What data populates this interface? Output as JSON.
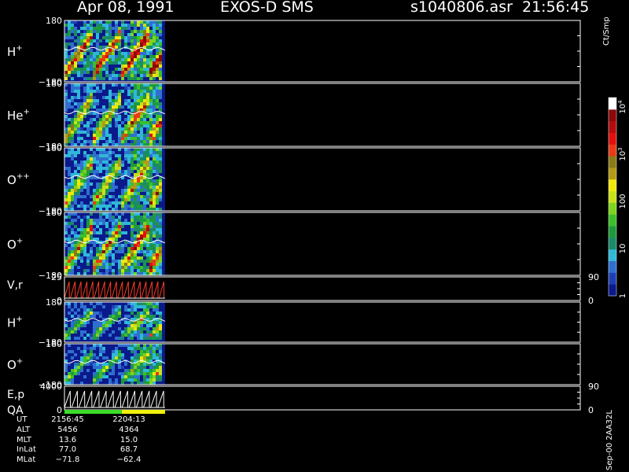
{
  "header": {
    "date": "Apr 08, 1991",
    "instrument": "EXOS-D SMS",
    "file_time": "s1040806.asr  21:56:45"
  },
  "colors": {
    "background": "#000000",
    "axes": "#ffffff",
    "colorscale": [
      "#0a1a8a",
      "#1e3fb4",
      "#2f6fd0",
      "#2fb8d8",
      "#1a8a6a",
      "#1e9a3c",
      "#3cbf2a",
      "#7ed41e",
      "#c8e01a",
      "#f0e80c",
      "#b49a14",
      "#8a7a18",
      "#e83a14",
      "#e0100c",
      "#b40c0c",
      "#8a0808",
      "#ffffff"
    ]
  },
  "colorbar": {
    "title": "Ct/Smp",
    "ticks": [
      {
        "value": 1,
        "label": "1"
      },
      {
        "value": 10,
        "label": "10"
      },
      {
        "value": 100,
        "label": "100"
      },
      {
        "value": 1000,
        "label": "10",
        "sup": "3"
      },
      {
        "value": 10000,
        "label": "10",
        "sup": "4"
      }
    ]
  },
  "chart_data": [
    {
      "type": "heatmap",
      "panel": "pitch-angle H+",
      "species": "H",
      "charge": "+",
      "y_range": [
        -180,
        180
      ],
      "y_tick_labels": [
        "180",
        "−180"
      ],
      "data_fraction": 0.195,
      "peak_level": 0.9,
      "noise_level": 0.35
    },
    {
      "type": "heatmap",
      "panel": "pitch-angle He+",
      "species": "He",
      "charge": "+",
      "y_range": [
        -180,
        180
      ],
      "y_tick_labels": [
        "180",
        "−180"
      ],
      "data_fraction": 0.195,
      "peak_level": 0.7,
      "noise_level": 0.25
    },
    {
      "type": "heatmap",
      "panel": "pitch-angle O++",
      "species": "O",
      "charge": "++",
      "y_range": [
        -180,
        180
      ],
      "y_tick_labels": [
        "180",
        "−180"
      ],
      "data_fraction": 0.195,
      "peak_level": 0.7,
      "noise_level": 0.25
    },
    {
      "type": "heatmap",
      "panel": "pitch-angle O+",
      "species": "O",
      "charge": "+",
      "y_range": [
        -180,
        180
      ],
      "y_tick_labels": [
        "180",
        "−180"
      ],
      "data_fraction": 0.195,
      "peak_level": 0.78,
      "noise_level": 0.28
    },
    {
      "type": "line",
      "panel": "V,r",
      "label": "V,r",
      "y_range": [
        0,
        25
      ],
      "y_tick_labels": [
        "25",
        "0"
      ],
      "right_tick_labels": [
        "90",
        "0"
      ],
      "data_fraction": 0.195,
      "cycles": 17
    },
    {
      "type": "heatmap",
      "panel": "spin H+",
      "species": "H",
      "charge": "+",
      "y_range": [
        -180,
        180
      ],
      "y_tick_labels": [
        "180",
        "−180"
      ],
      "data_fraction": 0.195,
      "peak_level": 0.45,
      "noise_level": 0.2
    },
    {
      "type": "heatmap",
      "panel": "spin O+",
      "species": "O",
      "charge": "+",
      "y_range": [
        -180,
        180
      ],
      "y_tick_labels": [
        "180",
        "−180"
      ],
      "data_fraction": 0.195,
      "peak_level": 0.45,
      "noise_level": 0.2
    },
    {
      "type": "line",
      "panel": "E,p",
      "label": "E,p",
      "y_range": [
        0,
        4000
      ],
      "y_tick_labels": [
        "4000",
        "0"
      ],
      "right_tick_labels": [
        "90",
        "0"
      ],
      "data_fraction": 0.195,
      "cycles": 14
    }
  ],
  "qa": {
    "label": "QA",
    "segments": [
      {
        "fraction": 0.57,
        "color": "#3cdc28"
      },
      {
        "fraction": 0.43,
        "color": "#f0f00c"
      }
    ]
  },
  "ephemeris": [
    {
      "key": "UT",
      "v1": "2156:45",
      "v2": "2204:13"
    },
    {
      "key": "ALT",
      "v1": "5456",
      "v2": "4364"
    },
    {
      "key": "MLT",
      "v1": "13.6",
      "v2": "15.0"
    },
    {
      "key": "InLat",
      "v1": "77.0",
      "v2": "68.7"
    },
    {
      "key": "MLat",
      "v1": "−71.8",
      "v2": "−62.4"
    }
  ],
  "footer_code": "Sep-00 2AA32L"
}
